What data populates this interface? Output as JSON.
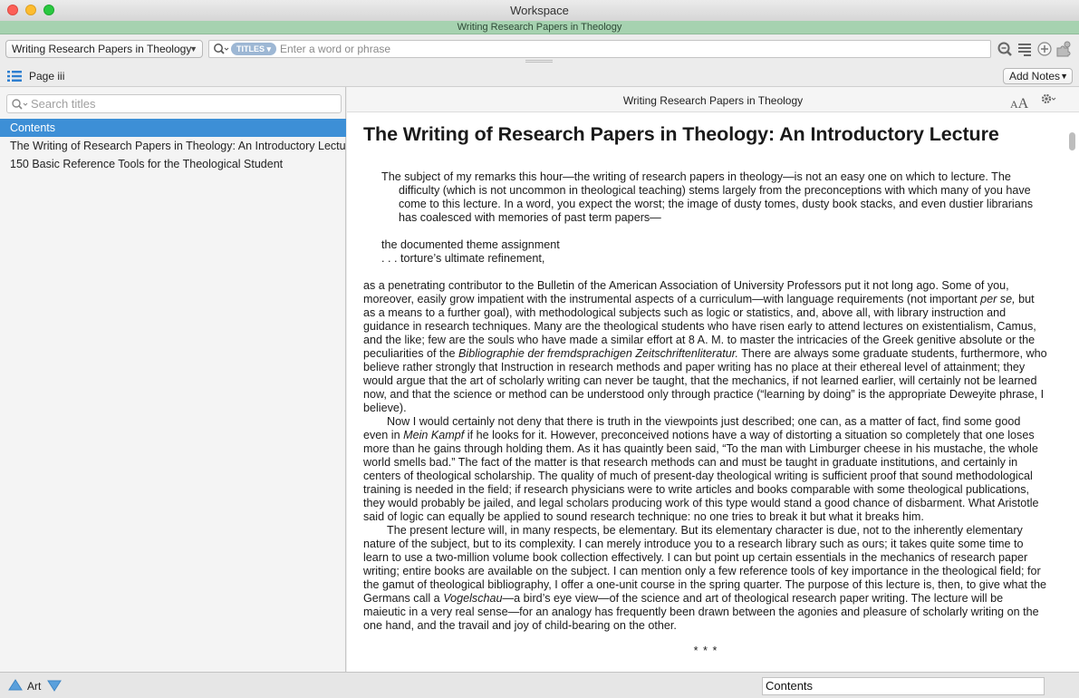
{
  "window": {
    "title": "Workspace",
    "resource_banner": "Writing Research Papers in Theology"
  },
  "toolbar": {
    "resource_select": "Writing Research Papers in Theology",
    "search_scope": "TITLES",
    "search_placeholder": "Enter a word or phrase"
  },
  "secondary_bar": {
    "page_label": "Page iii",
    "add_notes_label": "Add Notes"
  },
  "sidebar": {
    "search_placeholder": "Search titles",
    "items": [
      {
        "label": "Contents",
        "selected": true
      },
      {
        "label": "The Writing of Research Papers in Theology: An Introductory Lecture",
        "selected": false
      },
      {
        "label": "150 Basic Reference Tools for the Theological Student",
        "selected": false
      }
    ]
  },
  "content": {
    "header_title": "Writing Research Papers in Theology",
    "font_size_label": "AA",
    "heading": "The Writing of Research Papers in Theology: An Introductory Lecture",
    "quote": "The subject of my remarks this hour—the writing of research papers in theology—is not an easy one on which to lecture. The difficulty (which is not uncommon in theological teaching) stems largely from the preconceptions with which many of you have come to this lecture. In a word, you expect the worst; the image of dusty tomes, dusty book stacks, and even dustier librarians has coalesced with memories of past term papers—",
    "verse_line1": "the documented theme assignment",
    "verse_line2": ". . . torture’s ultimate refinement,",
    "p1_a": "as a penetrating contributor to the Bulletin of the American Association of University Professors put it not long ago. Some of you, moreover, easily grow impatient with the instrumental aspects of a curriculum—with language requirements (not important ",
    "p1_em1": "per se,",
    "p1_b": " but as a means to a further goal), with methodological subjects such as logic or statistics, and, above all, with library instruction and guidance in research techniques. Many are the theological students who have risen early to attend lectures on existentialism, Camus, and the like; few are the souls who have made a similar effort at 8 A. M. to master the intricacies of the Greek genitive absolute or the peculiarities of the ",
    "p1_em2": "Bibliographie der fremdsprachigen Zeitschriftenliteratur.",
    "p1_c": " There are always some graduate students, furthermore, who believe rather strongly that Instruction in research methods and paper writing has no place at their ethereal level of attainment; they would argue that the art of scholarly writing can never be taught, that the mechanics, if not learned earlier, will certainly not be learned now, and that the science or method can be understood only through practice (“learning by doing” is the appropriate Deweyite phrase, I believe).",
    "p2_a": "Now I would certainly not deny that there is truth in the viewpoints just described; one can, as a matter of fact, find some good even in ",
    "p2_em": "Mein Kampf",
    "p2_b": " if he looks for it. However, preconceived notions have a way of distorting a situation so completely that one loses more than he gains through holding them. As it has quaintly been said, “To the man with Limburger cheese in his mustache, the whole world smells bad.” The fact of the matter is that research methods can and must be taught in graduate institutions, and certainly in centers of theological scholarship. The quality of much of present-day theological writing is sufficient proof that sound methodological training is needed in the field; if research physicians were to write articles and books comparable with some theological publications, they would probably be jailed, and legal scholars producing work of this type would stand a good chance of disbarment. What Aristotle said of logic can equally be applied to sound research technique: no one tries to break it but what it breaks him.",
    "p3_a": "The present lecture will, in many respects, be elementary. But its elementary character is due, not to the inherently elementary nature of the subject, but to its complexity. I can merely introduce you to a research library such as ours; it takes quite some time to learn to use a two-million volume book collection effectively. I can but point up certain essentials in the mechanics of research paper writing; entire books are available on the subject. I can mention only a few reference tools of key importance in the theological field; for the gamut of theological bibliography, I offer a one-unit course in the spring quarter. The purpose of this lecture is, then, to give what the Germans call a ",
    "p3_em": "Vogelschau",
    "p3_b": "—a bird’s eye view—of the science and art of theological research paper writing. The lecture will be maieutic in a very real sense—for an analogy has frequently been drawn between the agonies and pleasure of scholarly writing on the one hand, and the travail and joy of child-bearing on the other.",
    "separator": "* * *"
  },
  "footer": {
    "art_label": "Art",
    "field_value": "Contents"
  }
}
